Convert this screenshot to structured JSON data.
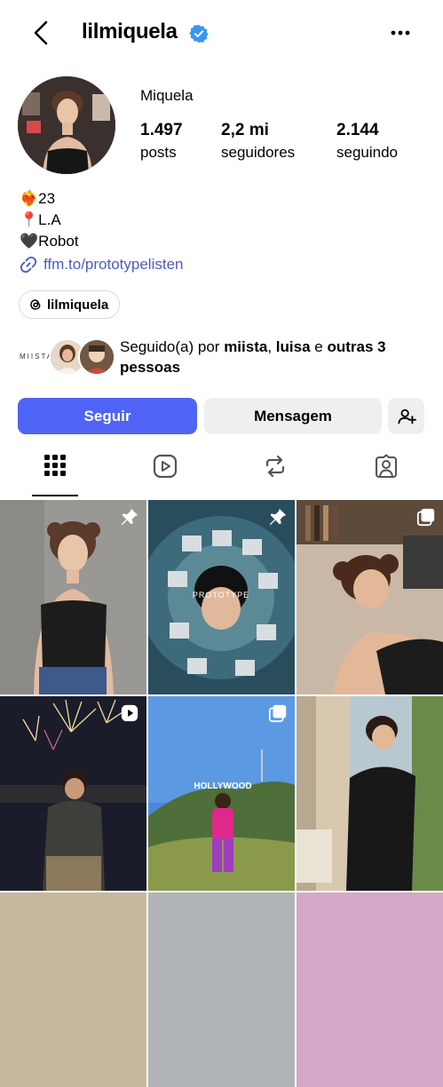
{
  "header": {
    "username": "lilmiquela",
    "back_icon": "back-arrow-icon",
    "more_icon": "more-options-icon"
  },
  "profile": {
    "display_name": "Miquela",
    "stats": [
      {
        "value": "1.497",
        "label": "posts"
      },
      {
        "value": "2,2 mi",
        "label": "seguidores"
      },
      {
        "value": "2.144",
        "label": "seguindo"
      }
    ],
    "bio": [
      {
        "emoji": "❤️‍🔥",
        "text": "23"
      },
      {
        "emoji": "📍",
        "text": "L.A"
      },
      {
        "emoji": "🖤",
        "text": "Robot"
      }
    ],
    "link": "ffm.to/prototypelisten",
    "threads_handle": "lilmiquela"
  },
  "followed_by": {
    "brand_label": "MIISTA",
    "prefix": "Seguido(a) por ",
    "name1": "miista",
    "sep": ", ",
    "name2": "luisa",
    "mid": " e ",
    "others": "outras 3 pessoas"
  },
  "actions": {
    "follow": "Seguir",
    "message": "Mensagem"
  },
  "tabs": [
    "posts-grid",
    "reels",
    "reposts",
    "tagged"
  ],
  "grid": {
    "prototype_label": "PROTOTYPE",
    "hollywood_label": "HOLLYWOOD"
  },
  "colors": {
    "accent": "#4f64f5",
    "verified": "#3897f0",
    "link": "#4a5dbf"
  }
}
